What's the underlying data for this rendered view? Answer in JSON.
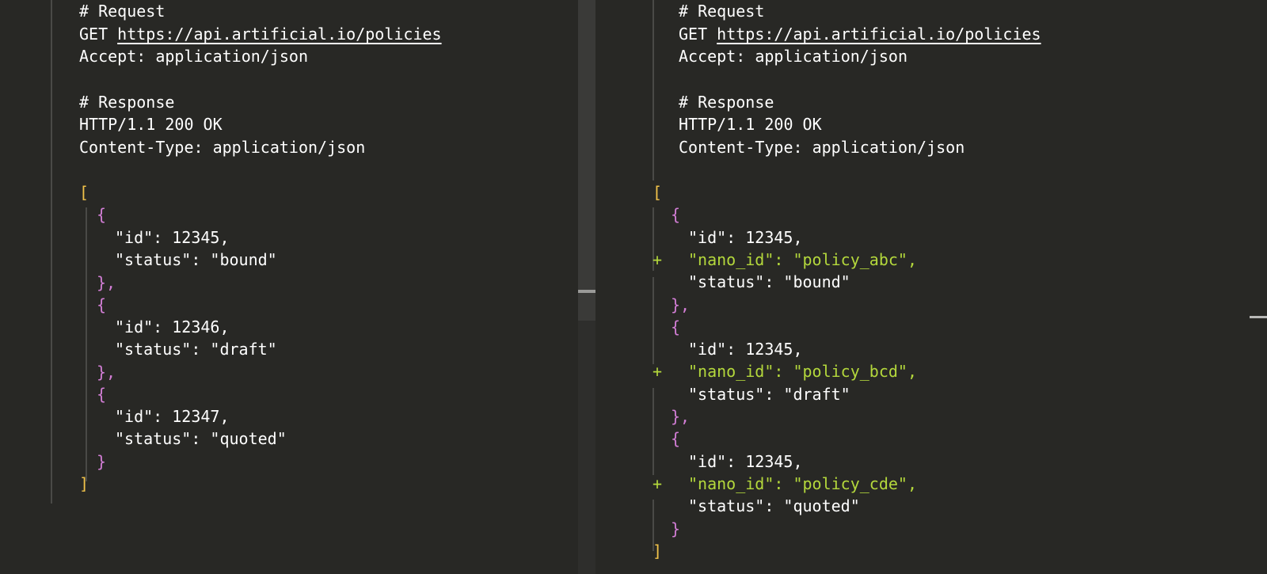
{
  "left": {
    "request_comment": "# Request",
    "request_method": "GET",
    "request_url": "https://api.artificial.io/policies",
    "request_accept": "Accept: application/json",
    "response_comment": "# Response",
    "response_status": "HTTP/1.1 200 OK",
    "response_content_type": "Content-Type: application/json",
    "open_bracket": "[",
    "close_bracket": "]",
    "items": [
      {
        "open": "{",
        "id_line": "\"id\": 12345,",
        "status_line": "\"status\": \"bound\"",
        "close": "},"
      },
      {
        "open": "{",
        "id_line": "\"id\": 12346,",
        "status_line": "\"status\": \"draft\"",
        "close": "},"
      },
      {
        "open": "{",
        "id_line": "\"id\": 12347,",
        "status_line": "\"status\": \"quoted\"",
        "close": "}"
      }
    ]
  },
  "right": {
    "request_comment": "# Request",
    "request_method": "GET",
    "request_url": "https://api.artificial.io/policies",
    "request_accept": "Accept: application/json",
    "response_comment": "# Response",
    "response_status": "HTTP/1.1 200 OK",
    "response_content_type": "Content-Type: application/json",
    "open_bracket": "[",
    "close_bracket": "]",
    "plus_marker": "+",
    "items": [
      {
        "open": "{",
        "id_line": "\"id\": 12345,",
        "nano_line": "\"nano_id\": \"policy_abc\",",
        "status_line": "\"status\": \"bound\"",
        "close": "},"
      },
      {
        "open": "{",
        "id_line": "\"id\": 12345,",
        "nano_line": "\"nano_id\": \"policy_bcd\",",
        "status_line": "\"status\": \"draft\"",
        "close": "},"
      },
      {
        "open": "{",
        "id_line": "\"id\": 12345,",
        "nano_line": "\"nano_id\": \"policy_cde\",",
        "status_line": "\"status\": \"quoted\"",
        "close": "}"
      }
    ]
  },
  "colors": {
    "background": "#282825",
    "text": "#ffffff",
    "added": "#b4d83c",
    "braces": "#d37ed6",
    "brackets": "#f1c24a"
  }
}
